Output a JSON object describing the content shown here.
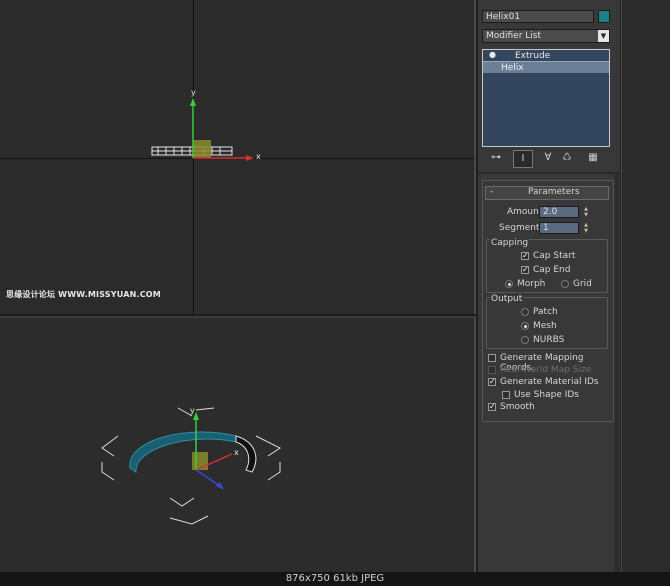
{
  "viewport_top": {
    "watermark": "思缘设计论坛 WWW.MISSYUAN.COM",
    "axis_y": "y",
    "axis_x": "x"
  },
  "viewport_bottom": {
    "axis_y": "y",
    "axis_x": "x"
  },
  "panel": {
    "object_name": "Helix01",
    "object_color": "#1d7e88",
    "modifier_list": "Modifier List",
    "stack": [
      "Extrude",
      "Helix"
    ],
    "stack_toolbar_icons": [
      "pin-stack-icon",
      "show-end-result-icon",
      "make-unique-icon",
      "remove-modifier-icon",
      "configure-modifier-sets-icon"
    ],
    "rollout_toggle": "-",
    "rollout_title": "Parameters",
    "amount_label": "Amount:",
    "amount_value": "2.0",
    "segments_label": "Segments:",
    "segments_value": "1",
    "capping": {
      "title": "Capping",
      "cap_start": "Cap Start",
      "cap_end": "Cap End",
      "morph": "Morph",
      "grid": "Grid"
    },
    "output": {
      "title": "Output",
      "patch": "Patch",
      "mesh": "Mesh",
      "nurbs": "NURBS"
    },
    "options": {
      "generate_mapping": "Generate Mapping Coords.",
      "real_world": "Real-World Map Size",
      "generate_material": "Generate Material IDs",
      "use_shape_ids": "Use Shape IDs",
      "smooth": "Smooth"
    }
  },
  "status_bar": "876x750  61kb  JPEG"
}
